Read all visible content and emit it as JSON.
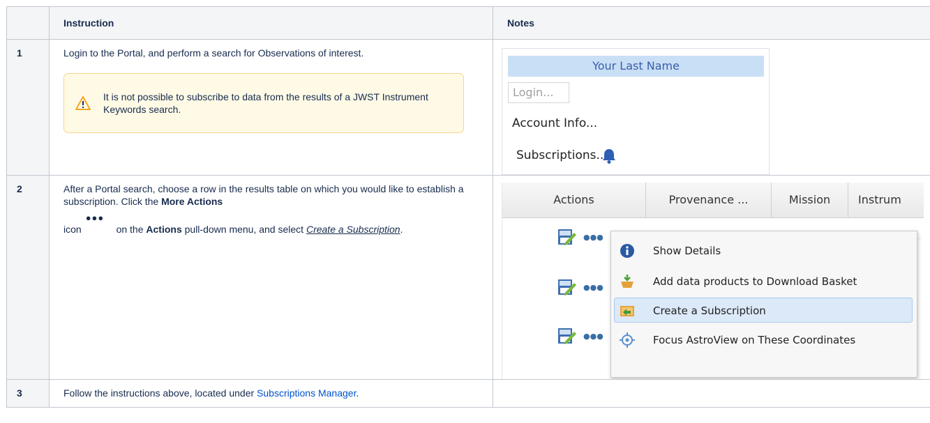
{
  "table": {
    "headers": {
      "number": "",
      "instruction": "Instruction",
      "notes": "Notes"
    },
    "rows": [
      {
        "number": "1",
        "instruction_text": "Login to the Portal, and perform a search for Observations of interest.",
        "warning_text": "It is not possible to subscribe to data from the results of a JWST Instrument Keywords search.",
        "notes_login": {
          "name": "Your Last Name",
          "login_button": "Login...",
          "account_info": "Account Info...",
          "subscriptions": "Subscriptions..."
        }
      },
      {
        "number": "2",
        "instruction_pre": "After a Portal search, choose a row in the results table on which you would like to establish a subscription. Click the ",
        "instruction_bold1": "More Actions",
        "instruction_icon_word": "icon",
        "instruction_dots": "●●●",
        "instruction_mid": " on the ",
        "instruction_bold2": "Actions",
        "instruction_post": " pull-down menu, and select ",
        "instruction_link": "Create a Subscription",
        "instruction_end": ".",
        "notes_grid": {
          "columns": [
            "Actions",
            "Provenance ...",
            "Mission",
            "Instrum"
          ],
          "menu_items": [
            {
              "label": "Show Details",
              "icon": "info-icon"
            },
            {
              "label": "Add data products to Download Basket",
              "icon": "download-basket-icon"
            },
            {
              "label": "Create a Subscription",
              "icon": "subscription-icon",
              "selected": true
            },
            {
              "label": "Focus AstroView on These Coordinates",
              "icon": "target-icon"
            }
          ]
        }
      },
      {
        "number": "3",
        "instruction_pre": "Follow the instructions above, located under ",
        "instruction_link": "Subscriptions Manager",
        "instruction_end": "."
      }
    ]
  },
  "colors": {
    "header_bg": "#f4f5f7",
    "border": "#c1c7d0",
    "warning_bg": "#fffae6",
    "link": "#0052cc",
    "menu_highlight": "#dbe9f9"
  }
}
